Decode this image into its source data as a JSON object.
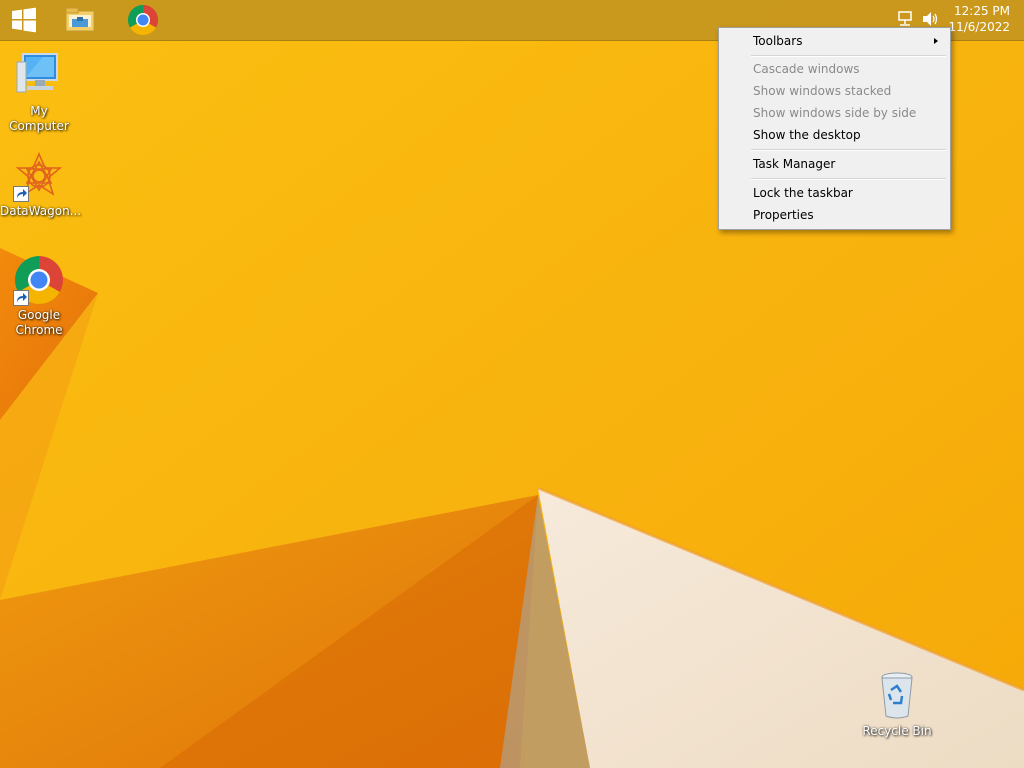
{
  "colors": {
    "wallpaper_base": "#f8b611",
    "wallpaper_dark": "#e88a08",
    "wallpaper_light": "#f6e9d2",
    "taskbar": "#c4961e",
    "menu_bg": "#f0f0f0",
    "menu_disabled_text": "#8a8a8a"
  },
  "taskbar": {
    "buttons": [
      {
        "icon": "windows-start-icon"
      },
      {
        "icon": "file-explorer-icon"
      },
      {
        "icon": "chrome-icon"
      }
    ],
    "tray": {
      "icons": [
        "network-icon",
        "volume-icon"
      ],
      "time": "12:25 PM",
      "date": "11/6/2022"
    }
  },
  "desktop_icons": [
    {
      "label": "My Computer",
      "icon": "computer-icon"
    },
    {
      "label": "DataWagon...",
      "icon": "datawagon-icon"
    },
    {
      "label": "Google Chrome",
      "icon": "chrome-icon"
    },
    {
      "label": "Recycle Bin",
      "icon": "recycle-bin-icon"
    }
  ],
  "context_menu": {
    "items": [
      {
        "label": "Toolbars",
        "enabled": true,
        "submenu": true
      },
      {
        "label": "Cascade windows",
        "enabled": false
      },
      {
        "label": "Show windows stacked",
        "enabled": false
      },
      {
        "label": "Show windows side by side",
        "enabled": false
      },
      {
        "label": "Show the desktop",
        "enabled": true
      },
      {
        "label": "Task Manager",
        "enabled": true
      },
      {
        "label": "Lock the taskbar",
        "enabled": true
      },
      {
        "label": "Properties",
        "enabled": true
      }
    ]
  }
}
